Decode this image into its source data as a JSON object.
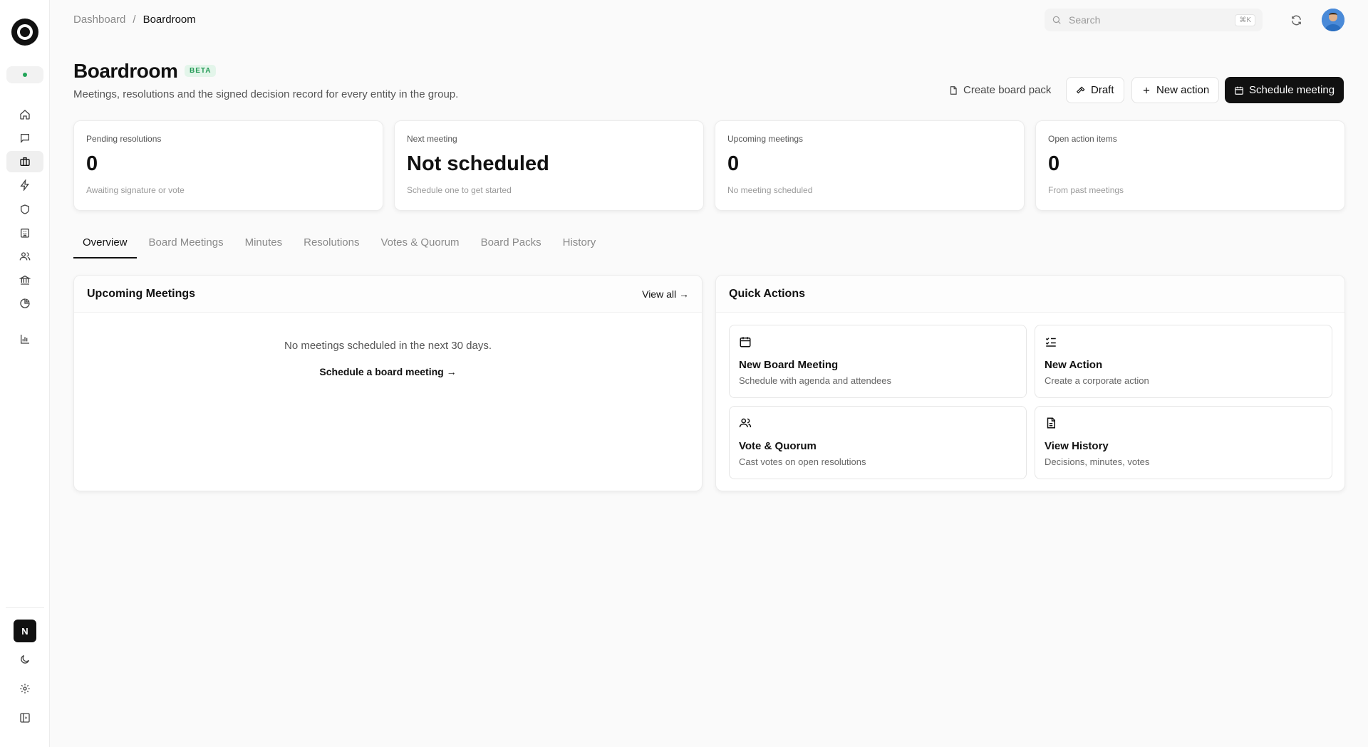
{
  "app": {
    "logo_name": "logo-icon"
  },
  "breadcrumb": {
    "parent": "Dashboard",
    "separator": "/",
    "current": "Boardroom"
  },
  "search": {
    "placeholder": "Search",
    "shortcut": "⌘K"
  },
  "sidebar": {
    "user_initial": "N",
    "items": [
      {
        "icon": "home-icon"
      },
      {
        "icon": "message-icon"
      },
      {
        "icon": "briefcase-icon",
        "active": true
      },
      {
        "icon": "lightning-icon"
      },
      {
        "icon": "shield-icon"
      },
      {
        "icon": "building-icon"
      },
      {
        "icon": "users-icon"
      },
      {
        "icon": "bank-icon"
      },
      {
        "icon": "pie-chart-icon"
      },
      {
        "icon": "bar-chart-icon"
      }
    ]
  },
  "header": {
    "title": "Boardroom",
    "badge": "BETA",
    "subtitle": "Meetings, resolutions and the signed decision record for every entity in the group."
  },
  "actions": {
    "create_board_pack": "Create board pack",
    "draft": "Draft",
    "new_action": "New action",
    "schedule_meeting": "Schedule meeting"
  },
  "stats": [
    {
      "label": "Pending resolutions",
      "value": "0",
      "note": "Awaiting signature or vote"
    },
    {
      "label": "Next meeting",
      "value": "Not scheduled",
      "note": "Schedule one to get started"
    },
    {
      "label": "Upcoming meetings",
      "value": "0",
      "note": "No meeting scheduled"
    },
    {
      "label": "Open action items",
      "value": "0",
      "note": "From past meetings"
    }
  ],
  "tabs": [
    "Overview",
    "Board Meetings",
    "Minutes",
    "Resolutions",
    "Votes & Quorum",
    "Board Packs",
    "History"
  ],
  "upcoming": {
    "title": "Upcoming Meetings",
    "view_all": "View all →",
    "empty_text": "No meetings scheduled in the next 30 days.",
    "empty_link": "Schedule a board meeting →"
  },
  "quick_actions": {
    "title": "Quick Actions",
    "items": [
      {
        "title": "New Board Meeting",
        "desc": "Schedule with agenda and attendees",
        "icon": "calendar-icon"
      },
      {
        "title": "New Action",
        "desc": "Create a corporate action",
        "icon": "checklist-icon"
      },
      {
        "title": "Vote & Quorum",
        "desc": "Cast votes on open resolutions",
        "icon": "users-icon"
      },
      {
        "title": "View History",
        "desc": "Decisions, minutes, votes",
        "icon": "document-icon"
      }
    ]
  },
  "colors": {
    "accent": "#111111",
    "beta_text": "#239a55",
    "beta_bg": "#e3f5ea",
    "status_dot": "#22a559"
  }
}
